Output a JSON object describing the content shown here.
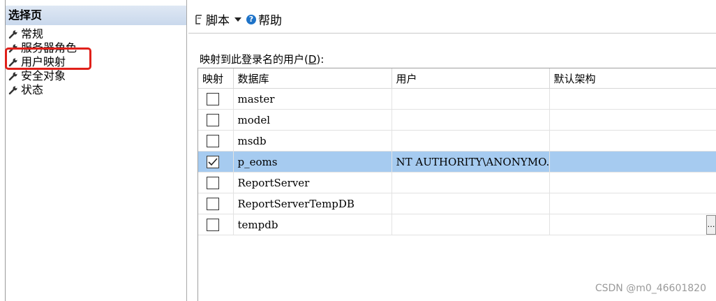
{
  "sidebar": {
    "title": "选择页",
    "items": [
      {
        "label": "常规"
      },
      {
        "label": "服务器角色"
      },
      {
        "label": "用户映射"
      },
      {
        "label": "安全对象"
      },
      {
        "label": "状态"
      }
    ],
    "highlight_color": "#e0201a"
  },
  "toolbar": {
    "script_label": "脚本",
    "help_label": "帮助"
  },
  "mapping": {
    "caption_prefix": "映射到此登录名的用户(",
    "caption_key": "D",
    "caption_suffix": "):",
    "columns": [
      "映射",
      "数据库",
      "用户",
      "默认架构"
    ],
    "rows": [
      {
        "checked": false,
        "database": "master",
        "user": "",
        "schema": ""
      },
      {
        "checked": false,
        "database": "model",
        "user": "",
        "schema": ""
      },
      {
        "checked": false,
        "database": "msdb",
        "user": "",
        "schema": ""
      },
      {
        "checked": true,
        "database": "p_eoms",
        "user": "NT AUTHORITY\\ANONYMO...",
        "schema": ""
      },
      {
        "checked": false,
        "database": "ReportServer",
        "user": "",
        "schema": ""
      },
      {
        "checked": false,
        "database": "ReportServerTempDB",
        "user": "",
        "schema": ""
      },
      {
        "checked": false,
        "database": "tempdb",
        "user": "",
        "schema": ""
      }
    ],
    "selected_row_color": "#a6cbf0"
  },
  "watermark": "CSDN @m0_46601820"
}
